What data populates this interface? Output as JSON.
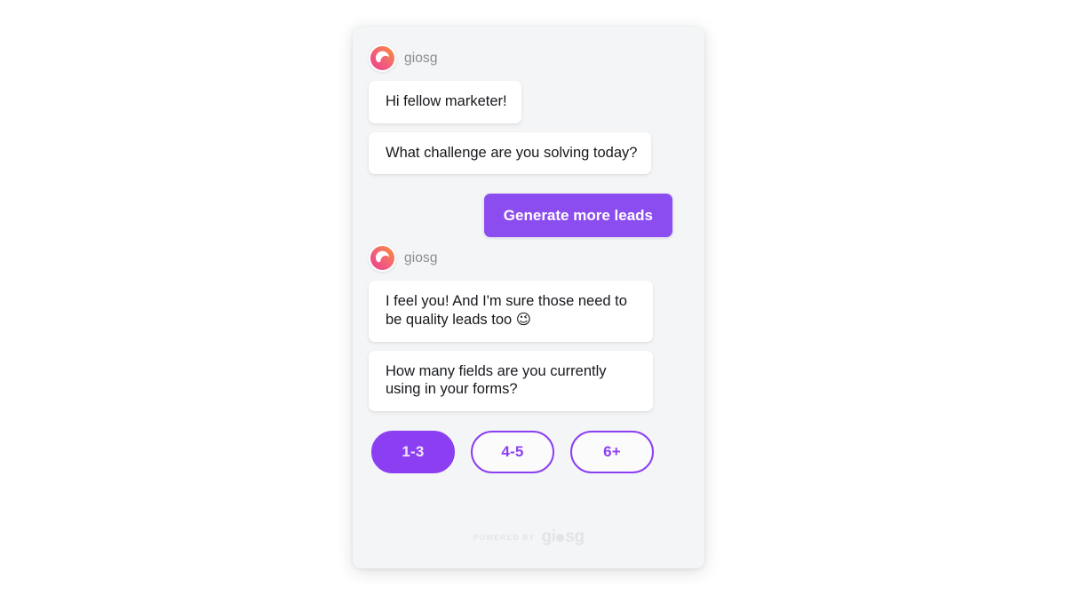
{
  "page": {
    "background_color": "#ffffff"
  },
  "widget": {
    "panel_background": "#f4f5f6",
    "accent_color": "#8c3ff2",
    "bubble_background": "#ffffff",
    "conversation": [
      {
        "type": "sender_header",
        "avatar_icon": "giosg-avatar-icon",
        "name": "giosg"
      },
      {
        "type": "bot_message",
        "text": "Hi fellow marketer!"
      },
      {
        "type": "bot_message",
        "text": "What challenge are you solving today?"
      },
      {
        "type": "user_reply",
        "text": "Generate more leads"
      },
      {
        "type": "sender_header",
        "avatar_icon": "giosg-avatar-icon",
        "name": "giosg"
      },
      {
        "type": "bot_message",
        "text": "I feel you! And I'm sure those need to be quality leads too 😉"
      },
      {
        "type": "bot_message",
        "text": "How many fields are you currently using in your forms?"
      }
    ],
    "messages": {
      "greeting": "Hi fellow marketer!",
      "question_1": "What challenge are you solving today?",
      "user_choice": "Generate more leads",
      "empathy": "I feel you! And I'm sure those need to be quality leads too 😉",
      "question_2": "How many fields are you currently using in your forms?"
    },
    "sender": {
      "name_1": "giosg",
      "name_2": "giosg",
      "avatar_gradient_from": "#f58a3b",
      "avatar_gradient_to": "#ee3b8f"
    },
    "quick_replies": [
      {
        "label": "1-3",
        "selected": true
      },
      {
        "label": "4-5",
        "selected": false
      },
      {
        "label": "6+",
        "selected": false
      }
    ],
    "footer": {
      "powered_by": "POWERED BY",
      "brand_prefix": "gi",
      "brand_suffix": "sg",
      "color": "#e2e4e6"
    }
  }
}
